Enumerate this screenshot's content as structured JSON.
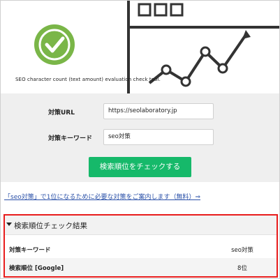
{
  "hero": {
    "caption": "SEO character count (text amount) evaluation check tool."
  },
  "form": {
    "url_label": "対策URL",
    "url_value": "https://seolaboratory.jp",
    "keyword_label": "対策キーワード",
    "keyword_value": "seo対策",
    "check_button": "検索順位をチェックする"
  },
  "guide_link": "「seo対策」で1位になるために必要な対策をご案内します（無料）⇒",
  "results": {
    "title": "検索順位チェック結果",
    "rows": [
      {
        "label": "対策キーワード",
        "value": "seo対策"
      },
      {
        "label": "検索順位 [Google]",
        "value": "8位"
      }
    ]
  },
  "colors": {
    "button_green": "#16b96a",
    "check_icon_green": "#7ab648",
    "highlight_red": "#e81c1c",
    "link_blue": "#2a50a8"
  }
}
